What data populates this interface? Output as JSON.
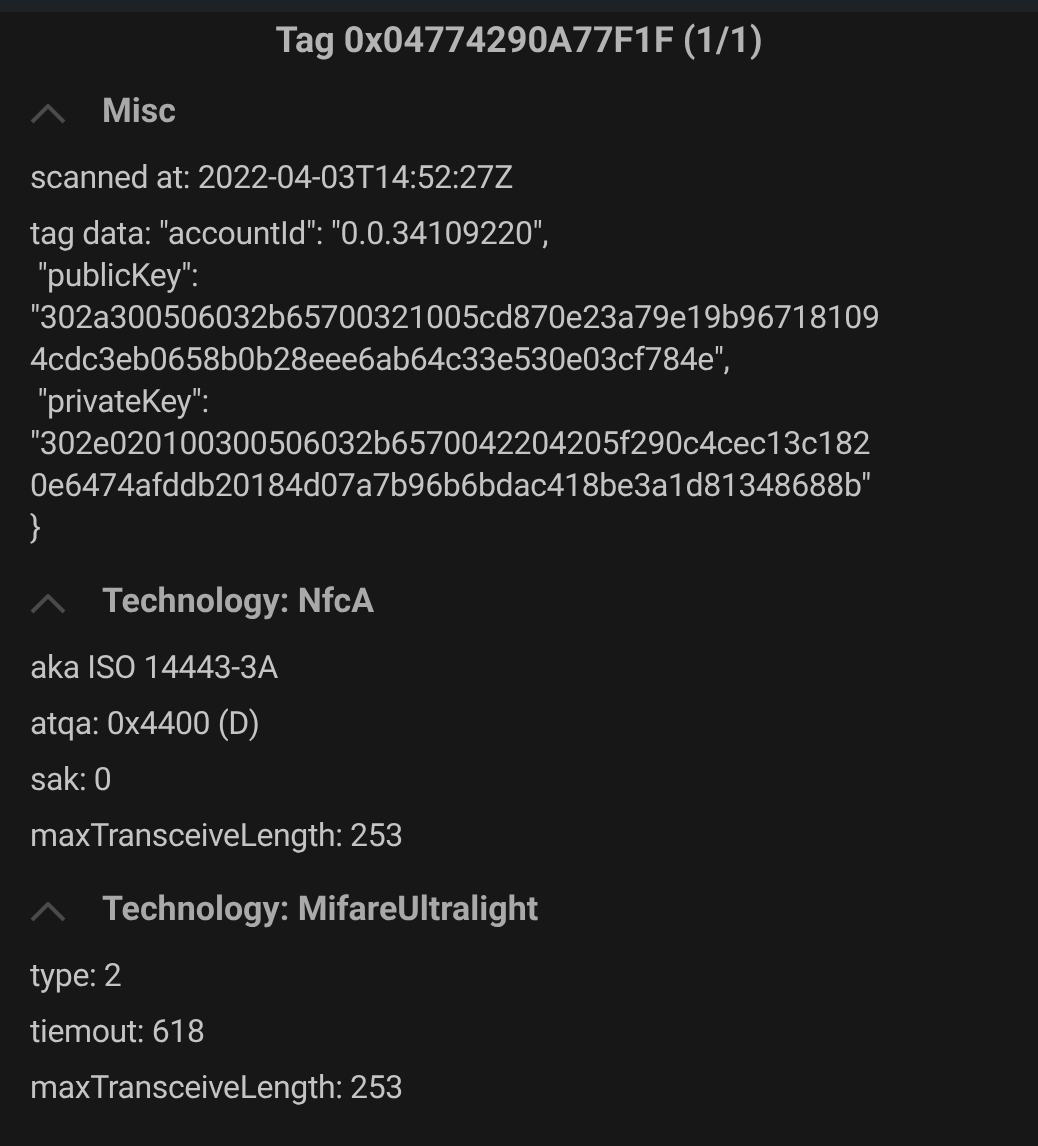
{
  "title": "Tag 0x04774290A77F1F (1/1)",
  "sections": [
    {
      "heading": "Misc",
      "expanded": true,
      "items": [
        {
          "lines": [
            "scanned at: 2022-04-03T14:52:27Z"
          ]
        },
        {
          "lines": [
            "tag data: \"accountId\": \"0.0.34109220\",",
            " \"publicKey\":",
            "\"302a300506032b65700321005cd870e23a79e19b96718109",
            "4cdc3eb0658b0b28eee6ab64c33e530e03cf784e\",",
            " \"privateKey\":",
            "\"302e020100300506032b6570042204205f290c4cec13c182",
            "0e6474afddb20184d07a7b96b6bdac418be3a1d81348688b\"",
            "}"
          ]
        }
      ]
    },
    {
      "heading": "Technology: NfcA",
      "expanded": true,
      "items": [
        {
          "lines": [
            "aka ISO 14443-3A"
          ]
        },
        {
          "lines": [
            "atqa: 0x4400 (D)"
          ]
        },
        {
          "lines": [
            "sak: 0"
          ]
        },
        {
          "lines": [
            "maxTransceiveLength: 253"
          ]
        }
      ]
    },
    {
      "heading": "Technology: MifareUltralight",
      "expanded": true,
      "items": [
        {
          "lines": [
            "type: 2"
          ]
        },
        {
          "lines": [
            "tiemout: 618"
          ]
        },
        {
          "lines": [
            "maxTransceiveLength: 253"
          ]
        }
      ]
    }
  ]
}
